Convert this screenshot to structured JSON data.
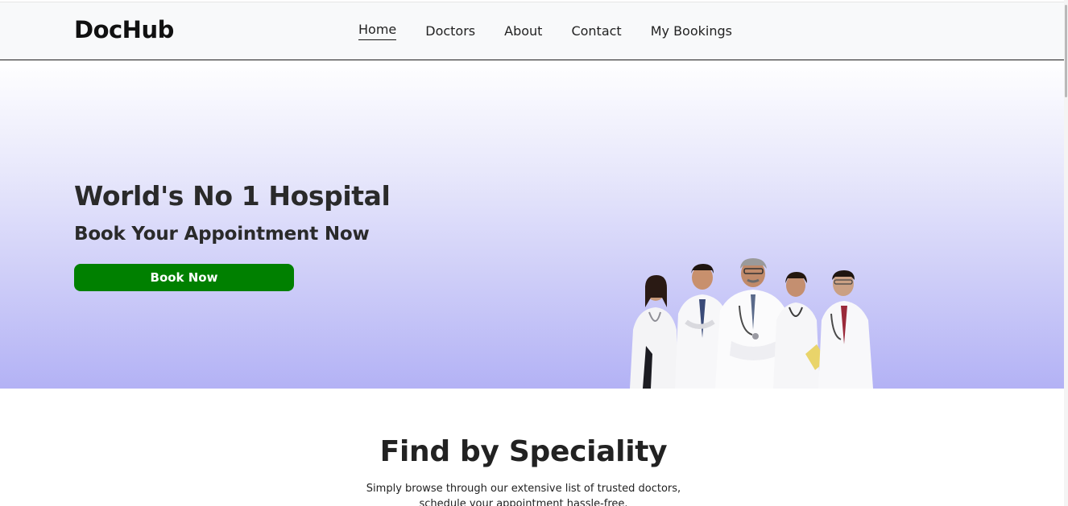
{
  "navbar": {
    "brand": "DocHub",
    "links": [
      {
        "label": "Home",
        "active": true
      },
      {
        "label": "Doctors",
        "active": false
      },
      {
        "label": "About",
        "active": false
      },
      {
        "label": "Contact",
        "active": false
      },
      {
        "label": "My Bookings",
        "active": false
      }
    ]
  },
  "hero": {
    "title": "World's No 1 Hospital",
    "subtitle": "Book Your Appointment Now",
    "button_label": "Book Now",
    "button_color": "#008000",
    "gradient_end_color": "#b3b2f5"
  },
  "speciality": {
    "title": "Find by Speciality",
    "description_line1": "Simply browse through our extensive list of trusted doctors,",
    "description_line2": "schedule your appointment hassle-free."
  }
}
